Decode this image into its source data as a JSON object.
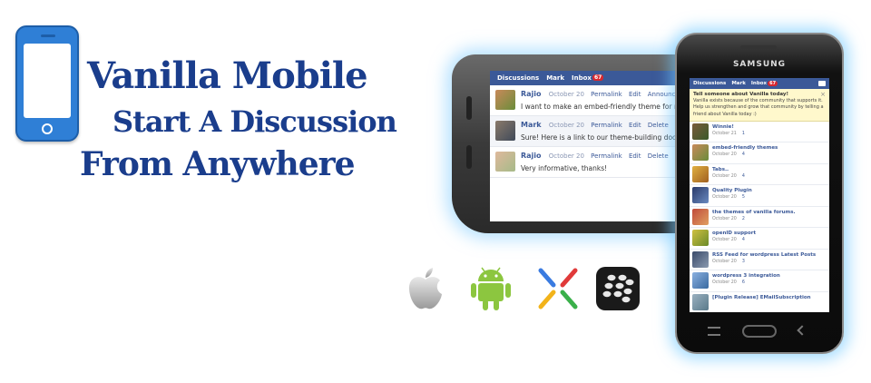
{
  "headline": {
    "line1": "Vanilla Mobile",
    "line2": "Start A Discussion",
    "line3": "From Anywhere"
  },
  "colors": {
    "headline": "#1a3d8c",
    "nav": "#3b5998",
    "glow": "#78c8ff",
    "phone_icon": "#2f7fd6",
    "badge": "#d8282f"
  },
  "icons": [
    "mobile-phone-icon",
    "apple-icon",
    "android-icon",
    "nexus-icon",
    "blackberry-icon"
  ],
  "landscape_phone": {
    "nav": {
      "discussions": "Discussions",
      "mark": "Mark",
      "inbox": "Inbox",
      "inbox_count": "67"
    },
    "posts": [
      {
        "author": "Rajio",
        "date": "October 20",
        "links": [
          "Permalink",
          "Edit",
          "Announce",
          "Si"
        ],
        "body": "I want to make an embed-friendly theme for m"
      },
      {
        "author": "Mark",
        "date": "October 20",
        "links": [
          "Permalink",
          "Edit",
          "Delete"
        ],
        "body": "Sure! Here is a link to our theme-building docu"
      },
      {
        "author": "Rajio",
        "date": "October 20",
        "links": [
          "Permalink",
          "Edit",
          "Delete"
        ],
        "body": "Very informative, thanks!"
      }
    ]
  },
  "portrait_phone": {
    "brand": "SAMSUNG",
    "nav": {
      "discussions": "Discussions",
      "mark": "Mark",
      "inbox": "Inbox",
      "inbox_count": "67"
    },
    "promo": {
      "title": "Tell someone about Vanilla today!",
      "text": "Vanilla exists because of the community that supports it. Help us strengthen and grow that community by telling a friend about Vanilla today :)",
      "close": "×"
    },
    "discussions": [
      {
        "title": "Winnie!",
        "date": "October 21",
        "count": "1"
      },
      {
        "title": "embed-friendly themes",
        "date": "October 20",
        "count": "4"
      },
      {
        "title": "Tabs..",
        "date": "October 20",
        "count": "4"
      },
      {
        "title": "Quality Plugin",
        "date": "October 20",
        "count": "5"
      },
      {
        "title": "the themes of vanilla forums.",
        "date": "October 20",
        "count": "2"
      },
      {
        "title": "openID support",
        "date": "October 20",
        "count": "4"
      },
      {
        "title": "RSS Feed for wordpress Latest Posts",
        "date": "October 20",
        "count": "3"
      },
      {
        "title": "wordpress 3 integration",
        "date": "October 20",
        "count": "6"
      },
      {
        "title": "[Plugin Release] EMailSubscription",
        "date": "",
        "count": ""
      }
    ]
  }
}
